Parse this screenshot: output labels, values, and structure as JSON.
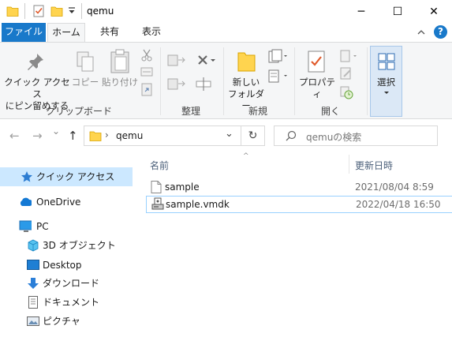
{
  "window": {
    "title": "qemu",
    "minimize": "─",
    "maximize": "☐",
    "close": "✕"
  },
  "tabs": {
    "file": "ファイル",
    "home": "ホーム",
    "share": "共有",
    "view": "表示"
  },
  "ribbon": {
    "pin_label_1": "クイック アクセス",
    "pin_label_2": "にピン留めする",
    "copy": "コピー",
    "paste": "貼り付け",
    "clipboard_group": "クリップボード",
    "organize_group": "整理",
    "new_folder_1": "新しい",
    "new_folder_2": "フォルダー",
    "new_group": "新規",
    "properties": "プロパティ",
    "open_group": "開く",
    "select": "選択"
  },
  "nav": {
    "back": "←",
    "forward": "→",
    "recent": "⌄",
    "up": "↑",
    "address_sep": "›",
    "address": "qemu",
    "address_dropdown": "⌄",
    "refresh": "↻",
    "search_placeholder": "qemuの検索"
  },
  "navpane": {
    "items": [
      {
        "label": "クイック アクセス"
      },
      {
        "label": "OneDrive"
      },
      {
        "label": "PC"
      },
      {
        "label": "3D オブジェクト"
      },
      {
        "label": "Desktop"
      },
      {
        "label": "ダウンロード"
      },
      {
        "label": "ドキュメント"
      },
      {
        "label": "ピクチャ"
      }
    ]
  },
  "filelist": {
    "col_name": "名前",
    "col_date": "更新日時",
    "rows": [
      {
        "name": "sample",
        "date": "2021/08/04 8:59"
      },
      {
        "name": "sample.vmdk",
        "date": "2022/04/18 16:50"
      }
    ]
  },
  "colors": {
    "accent": "#1979ca",
    "selection": "#cce8ff",
    "folder": "#ffd44f"
  }
}
